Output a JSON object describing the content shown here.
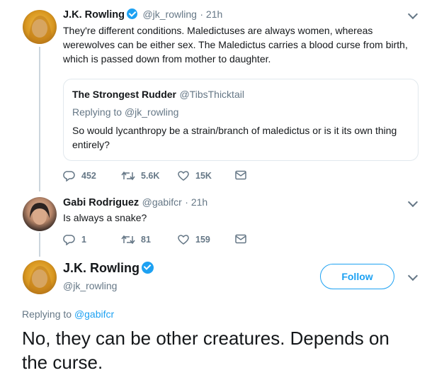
{
  "tweet1": {
    "name": "J.K. Rowling",
    "handle": "@jk_rowling",
    "time": "· 21h",
    "lines": [
      "They're different conditions. Maledictuses are always women, whereas",
      "werewolves can be either sex. The Maledictus carries a blood curse from birth,",
      "which is passed down from mother to daughter."
    ],
    "quote": {
      "name": "The Strongest Rudder",
      "handle": "@TibsThicktail",
      "replying_label": "Replying to",
      "replying_to": "@jk_rowling",
      "lines": [
        "So would lycanthropy be a strain/branch of maledictus or is it its own thing",
        "entirely?"
      ]
    },
    "actions": {
      "replies": "452",
      "retweets": "5.6K",
      "likes": "15K"
    }
  },
  "tweet2": {
    "name": "Gabi Rodriguez",
    "handle": "@gabifcr",
    "time": "· 21h",
    "text": "Is always a snake?",
    "actions": {
      "replies": "1",
      "retweets": "81",
      "likes": "159"
    }
  },
  "main_tweet": {
    "name": "J.K. Rowling",
    "handle": "@jk_rowling",
    "follow_label": "Follow",
    "replying_label": "Replying to",
    "replying_to": "@gabifcr",
    "lines": [
      "No, they can be other creatures. Depends on",
      "the curse."
    ],
    "accent_color": "#1da1f2"
  },
  "icons": [
    "reply-icon",
    "retweet-icon",
    "like-icon",
    "dm-icon",
    "verified-icon",
    "chevron-down-icon"
  ]
}
